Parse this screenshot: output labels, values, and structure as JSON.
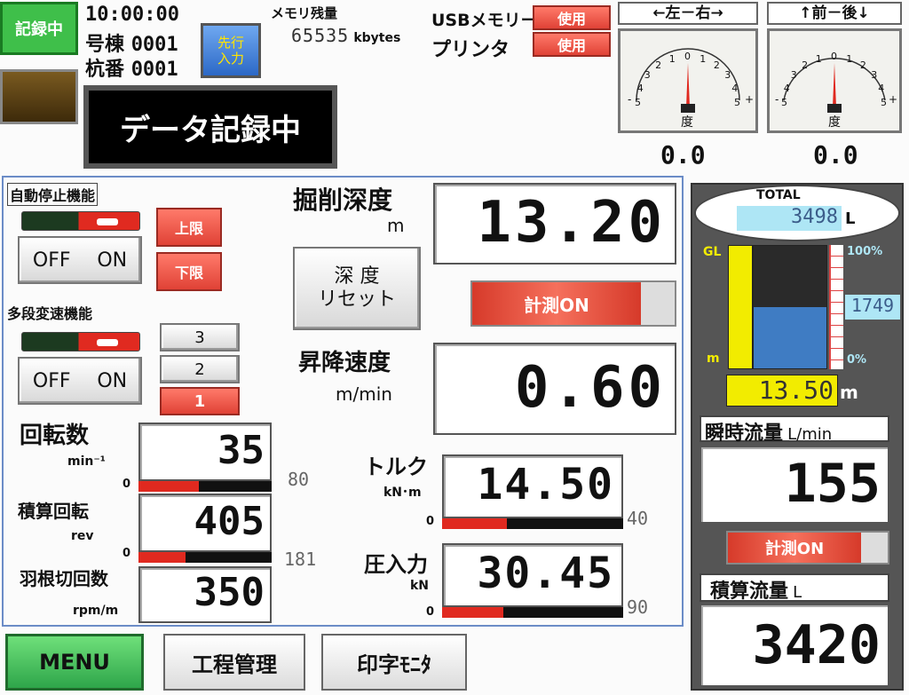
{
  "header": {
    "recording_badge": "記録中",
    "time": "10:00:00",
    "ridge_label": "号棟",
    "ridge_value": "0001",
    "pile_label": "杭番",
    "pile_value": "0001",
    "advance_input_button": "先行\n入力",
    "memory_label": "メモリ残量",
    "memory_value": "65535",
    "memory_unit": "kbytes",
    "usb_label": "USBメモリー",
    "usb_status": "使用",
    "printer_label": "プリンタ",
    "printer_status": "使用",
    "status_banner": "データ記録中"
  },
  "gauges": [
    {
      "title": "←左－右→",
      "unit": "度",
      "value": "0.0",
      "ticks": [
        "5",
        "4",
        "3",
        "2",
        "1",
        "0",
        "1",
        "2",
        "3",
        "4",
        "5"
      ],
      "minus": "-",
      "plus": "+"
    },
    {
      "title": "↑前－後↓",
      "unit": "度",
      "value": "0.0",
      "ticks": [
        "5",
        "4",
        "3",
        "2",
        "1",
        "0",
        "1",
        "2",
        "3",
        "4",
        "5"
      ],
      "minus": "-",
      "plus": "+"
    }
  ],
  "auto_stop": {
    "title": "自動停止機能",
    "off": "OFF",
    "on": "ON",
    "upper": "上限",
    "lower": "下限"
  },
  "multi_speed": {
    "title": "多段変速機能",
    "off": "OFF",
    "on": "ON",
    "levels": [
      "3",
      "2",
      "1"
    ],
    "active_level": "1"
  },
  "rotation": {
    "label": "回転数",
    "unit": "min⁻¹",
    "value": "35",
    "zero": "0",
    "max": "80",
    "fill": 0.45
  },
  "cumulative_rotation": {
    "label": "積算回転",
    "unit": "rev",
    "value": "405",
    "zero": "0",
    "max": "181",
    "fill": 0.35
  },
  "blade_cut": {
    "label": "羽根切回数",
    "unit": "rpm/m",
    "value": "350"
  },
  "depth": {
    "label": "掘削深度",
    "unit": "m",
    "value": "13.20",
    "reset_button": "深 度\nリセット",
    "measure_button": "計測ON"
  },
  "speed": {
    "label": "昇降速度",
    "unit": "m/min",
    "value": "0.60"
  },
  "torque": {
    "label": "トルク",
    "unit": "kN･m",
    "value": "14.50",
    "zero": "0",
    "max": "40",
    "fill": 0.36
  },
  "press": {
    "label": "圧入力",
    "unit": "kN",
    "value": "30.45",
    "zero": "0",
    "max": "90",
    "fill": 0.34
  },
  "tank": {
    "total_label": "TOTAL",
    "total_value": "3498",
    "total_unit": "L",
    "gl_label": "GL",
    "m_label": "m",
    "top_pct": "100%",
    "bottom_pct": "0%",
    "level_value": "1749",
    "level_fraction": 0.5,
    "depth_value": "13.50",
    "depth_unit": "m"
  },
  "flow": {
    "instant_label": "瞬時流量",
    "instant_unit": "L/min",
    "instant_value": "155",
    "measure_button": "計測ON",
    "cumulative_label": "積算流量",
    "cumulative_unit": "L",
    "cumulative_value": "3420"
  },
  "bottom_nav": {
    "menu": "MENU",
    "process": "工程管理",
    "print_monitor": "印字ﾓﾆﾀ"
  },
  "colors": {
    "menu_green": "#3cc85a",
    "alarm_red": "#e0291f",
    "lcd_blue": "#aee6f5",
    "tank_blue": "#3f7cc3",
    "yellow": "#f2ec00"
  }
}
